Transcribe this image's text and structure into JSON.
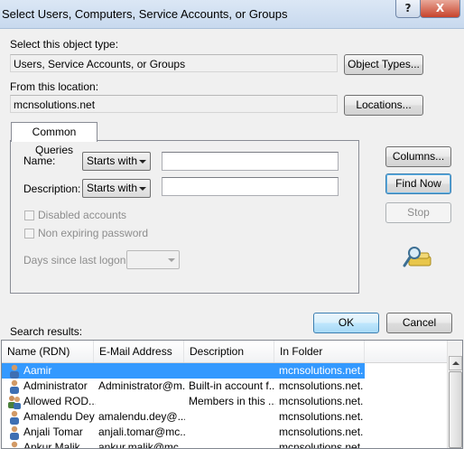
{
  "window": {
    "title": "Select Users, Computers, Service Accounts, or Groups",
    "help_glyph": "?",
    "close_glyph": "X"
  },
  "object_type": {
    "label": "Select this object type:",
    "value": "Users, Service Accounts, or Groups",
    "button": "Object Types..."
  },
  "location": {
    "label": "From this location:",
    "value": "mcnsolutions.net",
    "button": "Locations..."
  },
  "queries": {
    "tab_label": "Common Queries",
    "name_label": "Name:",
    "name_op": "Starts with",
    "name_value": "",
    "desc_label": "Description:",
    "desc_op": "Starts with",
    "desc_value": "",
    "disabled_accounts": "Disabled accounts",
    "non_expiring": "Non expiring password",
    "days_label": "Days since last logon:",
    "days_value": ""
  },
  "side_buttons": {
    "columns": "Columns...",
    "find_now": "Find Now",
    "stop": "Stop"
  },
  "dialog_buttons": {
    "ok": "OK",
    "cancel": "Cancel"
  },
  "results": {
    "label": "Search results:",
    "columns": [
      "Name (RDN)",
      "E-Mail Address",
      "Description",
      "In Folder"
    ],
    "rows": [
      {
        "name": "Aamir",
        "email": "",
        "description": "",
        "folder": "mcnsolutions.net...",
        "icon": "user-icon",
        "selected": true
      },
      {
        "name": "Administrator",
        "email": "Administrator@m...",
        "description": "Built-in account f...",
        "folder": "mcnsolutions.net...",
        "icon": "user-icon",
        "selected": false
      },
      {
        "name": "Allowed ROD...",
        "email": "",
        "description": "Members in this ...",
        "folder": "mcnsolutions.net...",
        "icon": "group-icon",
        "selected": false
      },
      {
        "name": "Amalendu Dey",
        "email": "amalendu.dey@...",
        "description": "",
        "folder": "mcnsolutions.net...",
        "icon": "user-icon",
        "selected": false
      },
      {
        "name": "Anjali Tomar",
        "email": "anjali.tomar@mc...",
        "description": "",
        "folder": "mcnsolutions.net...",
        "icon": "user-icon",
        "selected": false
      },
      {
        "name": "Ankur Malik",
        "email": "ankur.malik@mc...",
        "description": "",
        "folder": "mcnsolutions.net...",
        "icon": "user-icon",
        "selected": false
      }
    ]
  },
  "colors": {
    "selection": "#3399ff",
    "close_button": "#c7432b",
    "default_button_border": "#3c7fb1"
  }
}
